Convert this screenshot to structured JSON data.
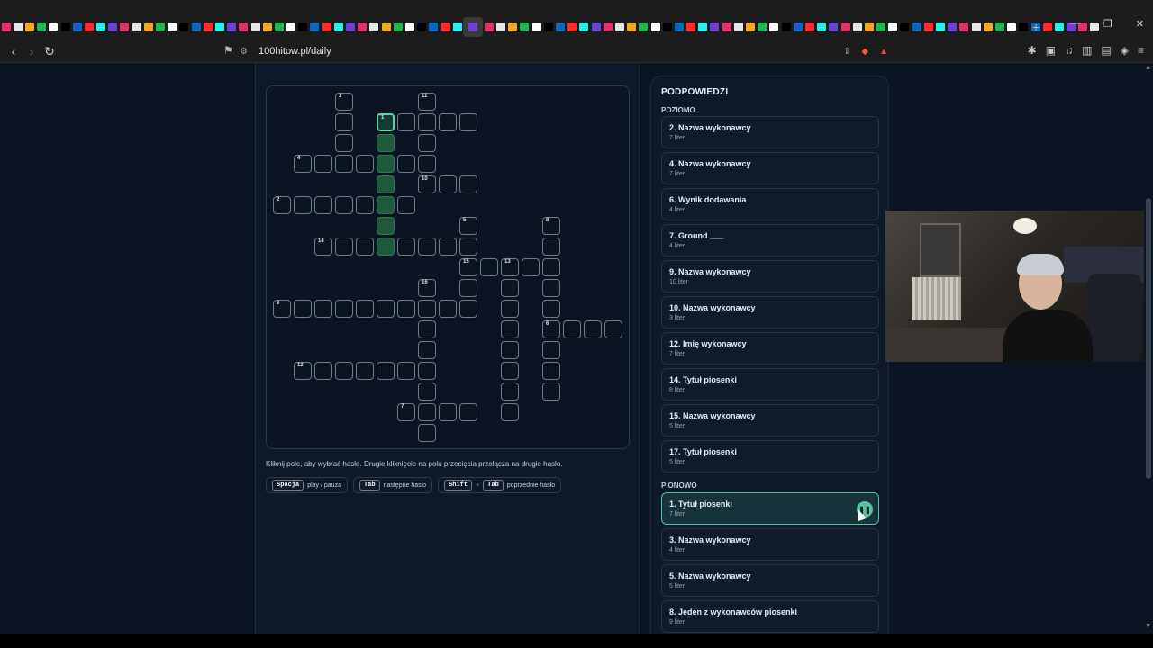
{
  "browser": {
    "tab_count": 92,
    "new_tab_label": "+",
    "url": "100hitow.pl/daily",
    "win_min": "—",
    "win_max": "❐",
    "win_close": "✕"
  },
  "hint": "Kliknij pole, aby wybrać hasło. Drugie kliknięcie na polu przecięcia przełącza na drugie hasło.",
  "shortcuts": [
    {
      "keys": [
        "Spacja"
      ],
      "label": "play / pauza"
    },
    {
      "keys": [
        "Tab"
      ],
      "label": "następne hasło"
    },
    {
      "keys": [
        "Shift",
        "Tab"
      ],
      "label": "poprzednie hasło"
    }
  ],
  "panel": {
    "title": "PODPOWIEDZI",
    "across_label": "POZIOMO",
    "down_label": "PIONOWO",
    "across": [
      {
        "title": "2. Nazwa wykonawcy",
        "sub": "7 liter"
      },
      {
        "title": "4. Nazwa wykonawcy",
        "sub": "7 liter"
      },
      {
        "title": "6. Wynik dodawania",
        "sub": "4 liter"
      },
      {
        "title": "7. Ground ___",
        "sub": "4 liter"
      },
      {
        "title": "9. Nazwa wykonawcy",
        "sub": "10 liter"
      },
      {
        "title": "10. Nazwa wykonawcy",
        "sub": "3 liter"
      },
      {
        "title": "12. Imię wykonawcy",
        "sub": "7 liter"
      },
      {
        "title": "14. Tytuł piosenki",
        "sub": "8 liter"
      },
      {
        "title": "15. Nazwa wykonawcy",
        "sub": "5 liter"
      },
      {
        "title": "17. Tytuł piosenki",
        "sub": "5 liter"
      }
    ],
    "down": [
      {
        "title": "1. Tytuł piosenki",
        "sub": "7 liter",
        "active": true
      },
      {
        "title": "3. Nazwa wykonawcy",
        "sub": "4 liter"
      },
      {
        "title": "5. Nazwa wykonawcy",
        "sub": "5 liter"
      },
      {
        "title": "8. Jeden z wykonawców piosenki",
        "sub": "9 liter"
      }
    ],
    "pause_icon": "❚❚"
  },
  "crossword": {
    "cells": [
      [
        3,
        0,
        "3"
      ],
      [
        7,
        0,
        "11"
      ],
      [
        3,
        1,
        ""
      ],
      [
        5,
        1,
        "1"
      ],
      [
        6,
        1,
        ""
      ],
      [
        7,
        1,
        ""
      ],
      [
        8,
        1,
        ""
      ],
      [
        9,
        1,
        ""
      ],
      [
        3,
        2,
        ""
      ],
      [
        5,
        2,
        ""
      ],
      [
        7,
        2,
        ""
      ],
      [
        1,
        3,
        "4"
      ],
      [
        2,
        3,
        ""
      ],
      [
        3,
        3,
        ""
      ],
      [
        4,
        3,
        ""
      ],
      [
        5,
        3,
        ""
      ],
      [
        6,
        3,
        ""
      ],
      [
        7,
        3,
        ""
      ],
      [
        5,
        4,
        ""
      ],
      [
        7,
        4,
        "10"
      ],
      [
        8,
        4,
        ""
      ],
      [
        9,
        4,
        ""
      ],
      [
        0,
        5,
        "2"
      ],
      [
        1,
        5,
        ""
      ],
      [
        2,
        5,
        ""
      ],
      [
        3,
        5,
        ""
      ],
      [
        4,
        5,
        ""
      ],
      [
        5,
        5,
        ""
      ],
      [
        6,
        5,
        ""
      ],
      [
        5,
        6,
        ""
      ],
      [
        9,
        6,
        "5"
      ],
      [
        13,
        6,
        "8"
      ],
      [
        2,
        7,
        "14"
      ],
      [
        3,
        7,
        ""
      ],
      [
        4,
        7,
        ""
      ],
      [
        5,
        7,
        ""
      ],
      [
        6,
        7,
        ""
      ],
      [
        7,
        7,
        ""
      ],
      [
        8,
        7,
        ""
      ],
      [
        9,
        7,
        ""
      ],
      [
        13,
        7,
        ""
      ],
      [
        9,
        8,
        "15"
      ],
      [
        10,
        8,
        ""
      ],
      [
        11,
        8,
        "13"
      ],
      [
        12,
        8,
        ""
      ],
      [
        13,
        8,
        ""
      ],
      [
        7,
        9,
        "16"
      ],
      [
        9,
        9,
        ""
      ],
      [
        11,
        9,
        ""
      ],
      [
        13,
        9,
        ""
      ],
      [
        0,
        10,
        "9"
      ],
      [
        1,
        10,
        ""
      ],
      [
        2,
        10,
        ""
      ],
      [
        3,
        10,
        ""
      ],
      [
        4,
        10,
        ""
      ],
      [
        5,
        10,
        ""
      ],
      [
        6,
        10,
        ""
      ],
      [
        7,
        10,
        ""
      ],
      [
        8,
        10,
        ""
      ],
      [
        9,
        10,
        ""
      ],
      [
        11,
        10,
        ""
      ],
      [
        13,
        10,
        ""
      ],
      [
        7,
        11,
        ""
      ],
      [
        11,
        11,
        ""
      ],
      [
        13,
        11,
        "6"
      ],
      [
        14,
        11,
        ""
      ],
      [
        15,
        11,
        ""
      ],
      [
        16,
        11,
        ""
      ],
      [
        7,
        12,
        ""
      ],
      [
        11,
        12,
        ""
      ],
      [
        13,
        12,
        ""
      ],
      [
        1,
        13,
        "12"
      ],
      [
        2,
        13,
        ""
      ],
      [
        3,
        13,
        ""
      ],
      [
        4,
        13,
        ""
      ],
      [
        5,
        13,
        ""
      ],
      [
        6,
        13,
        ""
      ],
      [
        7,
        13,
        ""
      ],
      [
        11,
        13,
        ""
      ],
      [
        13,
        13,
        ""
      ],
      [
        7,
        14,
        ""
      ],
      [
        11,
        14,
        ""
      ],
      [
        13,
        14,
        ""
      ],
      [
        6,
        15,
        "7"
      ],
      [
        7,
        15,
        ""
      ],
      [
        8,
        15,
        ""
      ],
      [
        9,
        15,
        ""
      ],
      [
        11,
        15,
        ""
      ],
      [
        7,
        16,
        ""
      ]
    ],
    "highlight_col": 5,
    "highlight_rows": [
      1,
      2,
      3,
      4,
      5,
      6,
      7
    ],
    "selected": [
      5,
      1
    ]
  }
}
